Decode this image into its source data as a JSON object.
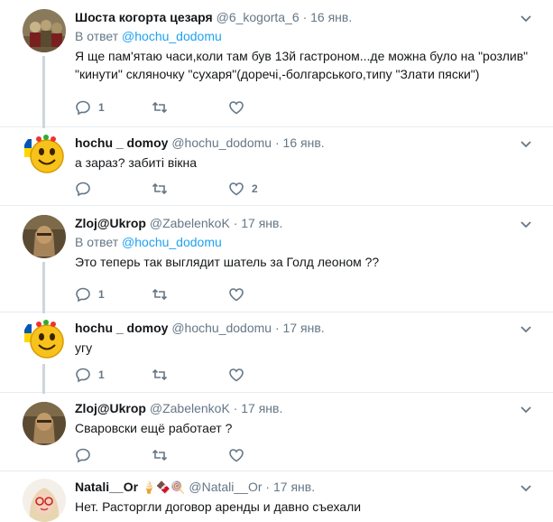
{
  "tweets": [
    {
      "name": "Шоста когорта цезаря",
      "handle": "@6_kogorta_6",
      "dot": "·",
      "date": "16 янв.",
      "reply_prefix": "В ответ",
      "reply_to": "@hochu_dodomu",
      "text": "Я ще пам'ятаю часи,коли там був 13й гастроном...де можна було на \"розлив\" \"кинути\" скляночку \"сухаря\"(доречі,-болгарського,типу \"Злати пяски\")",
      "reply_count": "1",
      "retweet_count": "",
      "like_count": ""
    },
    {
      "name": "hochu _ domoy",
      "handle": "@hochu_dodomu",
      "dot": "·",
      "date": "16 янв.",
      "text": "а зараз? забиті вікна",
      "reply_count": "",
      "retweet_count": "",
      "like_count": "2"
    },
    {
      "name": "Zloj@Ukrop",
      "handle": "@ZabelenkoK",
      "dot": "·",
      "date": "17 янв.",
      "reply_prefix": "В ответ",
      "reply_to": "@hochu_dodomu",
      "text": "Это теперь так выглядит шатель за Голд леоном ??",
      "reply_count": "1",
      "retweet_count": "",
      "like_count": ""
    },
    {
      "name": "hochu _ domoy",
      "handle": "@hochu_dodomu",
      "dot": "·",
      "date": "17 янв.",
      "text": "угу",
      "reply_count": "1",
      "retweet_count": "",
      "like_count": ""
    },
    {
      "name": "Zloj@Ukrop",
      "handle": "@ZabelenkoK",
      "dot": "·",
      "date": "17 янв.",
      "text": "Сваровски ещё работает ?",
      "reply_count": "",
      "retweet_count": "",
      "like_count": ""
    },
    {
      "name": "Natali__Or",
      "name_emoji": "🍦🍫🍭",
      "handle": "@Natali__Or",
      "dot": "·",
      "date": "17 янв.",
      "text": "Нет. Расторгли договор аренды и давно съехали"
    }
  ],
  "icons": {
    "reply": "reply-icon",
    "retweet": "retweet-icon",
    "like": "heart-icon",
    "caret": "chevron-down-icon"
  },
  "colors": {
    "link": "#1da1f2",
    "muted": "#657786",
    "text": "#14171a",
    "thread_line": "#ccd6dd"
  }
}
